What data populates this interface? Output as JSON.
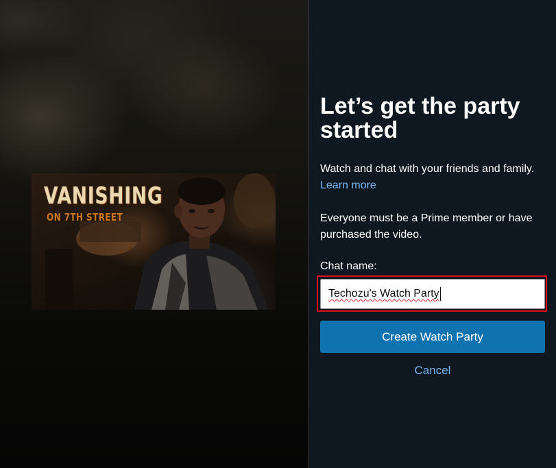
{
  "video": {
    "title_line1": "VANISHING",
    "title_line2": "ON 7TH STREET"
  },
  "dialog": {
    "heading": "Let’s get the party started",
    "intro_text": "Watch and chat with your friends and family.",
    "learn_more_label": "Learn more",
    "notice": "Everyone must be a Prime member or have purchased the video.",
    "chat_name_label": "Chat name:",
    "chat_name_value": "Techozu's Watch Party",
    "create_button_label": "Create Watch Party",
    "cancel_label": "Cancel"
  },
  "colors": {
    "panel_background": "#0f1720",
    "primary_button": "#1172b0",
    "link": "#79b8f3",
    "highlight_border": "#e0101a"
  }
}
